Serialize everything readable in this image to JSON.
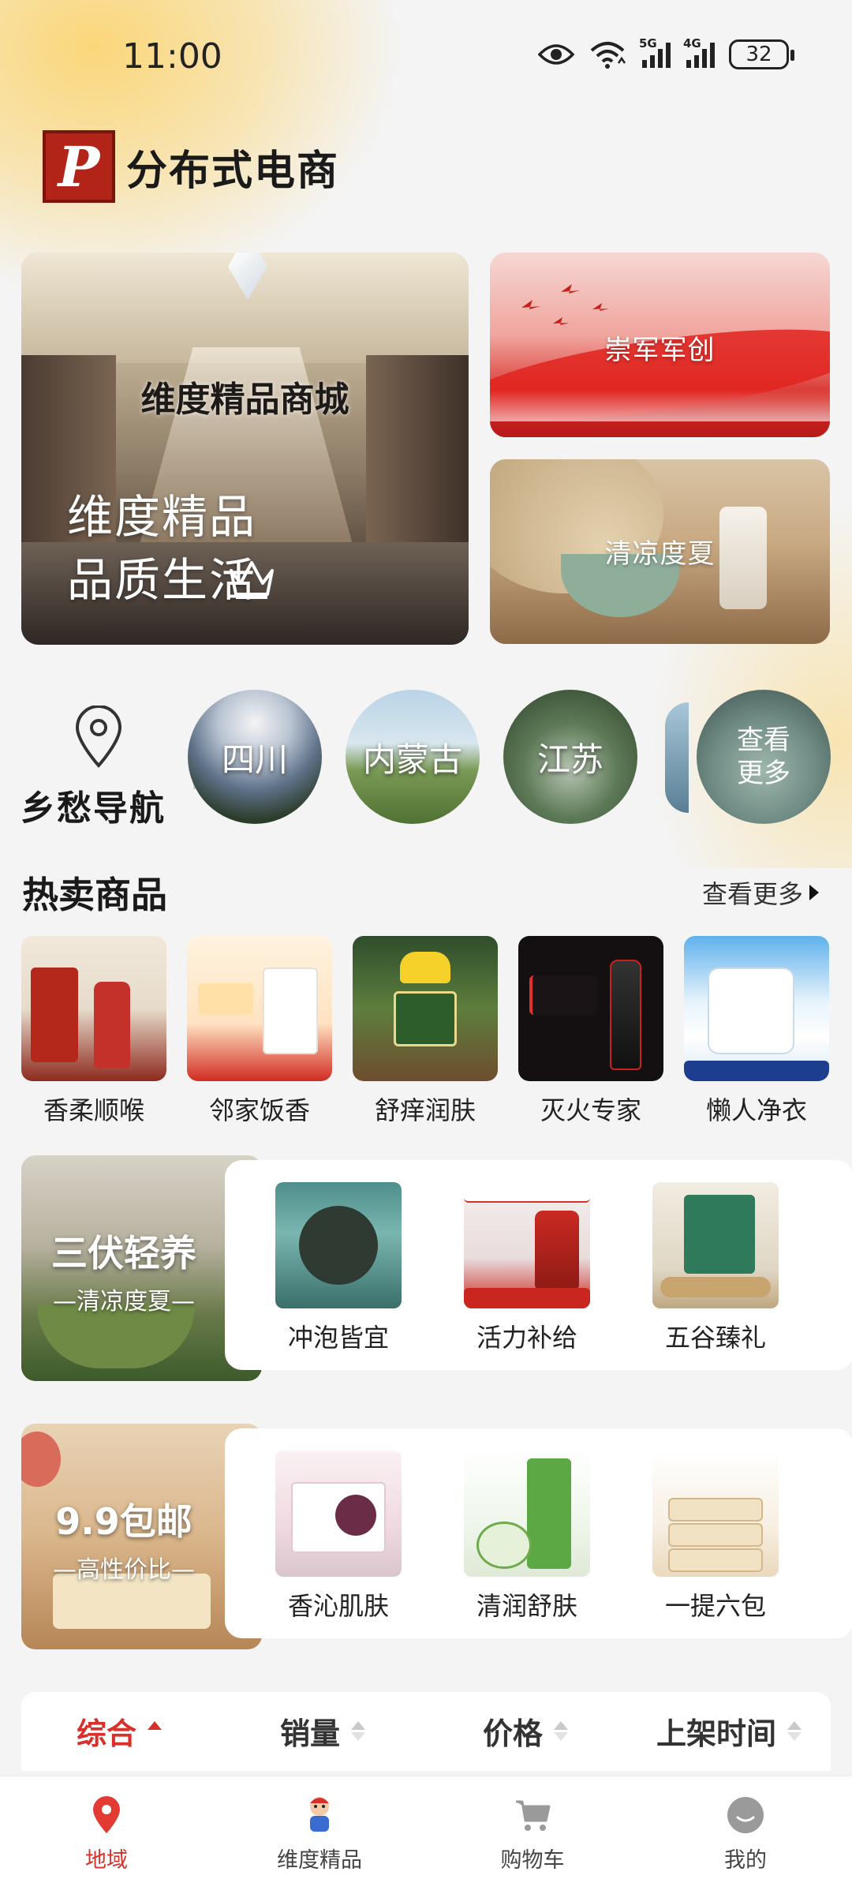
{
  "status_bar": {
    "time": "11:00",
    "signal_tags": [
      "5G",
      "4G"
    ],
    "battery": "32"
  },
  "header": {
    "logo_text": "分布式电商"
  },
  "banners": {
    "main": {
      "sign_text": "维度精品商城",
      "slogan_line1": "维度精品",
      "slogan_line2": "品质生活"
    },
    "side_top": {
      "label": "崇军军创"
    },
    "side_bottom": {
      "label": "清凉度夏"
    }
  },
  "region_nav": {
    "title": "乡愁导航",
    "items": [
      {
        "label": "四川"
      },
      {
        "label": "内蒙古"
      },
      {
        "label": "江苏"
      }
    ],
    "more_line1": "查看",
    "more_line2": "更多"
  },
  "hot_products": {
    "title": "热卖商品",
    "more_label": "查看更多",
    "items": [
      {
        "name": "香柔顺喉"
      },
      {
        "name": "邻家饭香"
      },
      {
        "name": "舒痒润肤"
      },
      {
        "name": "灭火专家"
      },
      {
        "name": "懒人净衣"
      }
    ]
  },
  "promos": [
    {
      "title": "三伏轻养",
      "subtitle": "—清凉度夏—",
      "products": [
        {
          "name": "冲泡皆宜"
        },
        {
          "name": "活力补给"
        },
        {
          "name": "五谷臻礼"
        }
      ]
    },
    {
      "title": "9.9包邮",
      "subtitle": "—高性价比—",
      "products": [
        {
          "name": "香沁肌肤"
        },
        {
          "name": "清润舒肤"
        },
        {
          "name": "一提六包"
        }
      ]
    }
  ],
  "sort_bar": {
    "items": [
      {
        "label": "综合"
      },
      {
        "label": "销量"
      },
      {
        "label": "价格"
      },
      {
        "label": "上架时间"
      }
    ],
    "active_index": 0
  },
  "tab_bar": {
    "items": [
      {
        "label": "地域",
        "icon": "location-pin-icon"
      },
      {
        "label": "维度精品",
        "icon": "mascot-icon"
      },
      {
        "label": "购物车",
        "icon": "cart-icon"
      },
      {
        "label": "我的",
        "icon": "profile-icon"
      }
    ],
    "active_index": 0
  },
  "colors": {
    "accent": "#d6322b",
    "background": "#f4f4f5",
    "glow": "#fbd77a"
  }
}
